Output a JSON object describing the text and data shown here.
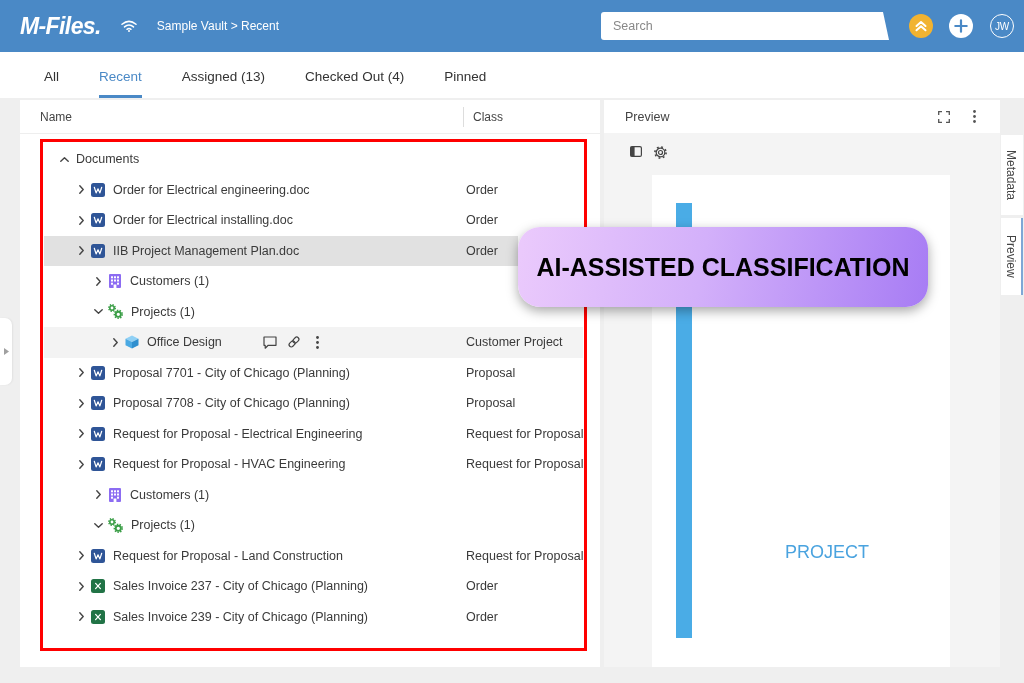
{
  "header": {
    "logo": "M-Files.",
    "breadcrumb": "Sample Vault > Recent",
    "search": {
      "placeholder": "Search"
    },
    "avatar": "JW"
  },
  "tabs": [
    {
      "label": "All",
      "selected": false
    },
    {
      "label": "Recent",
      "selected": true
    },
    {
      "label": "Assigned (13)",
      "selected": false
    },
    {
      "label": "Checked Out (4)",
      "selected": false
    },
    {
      "label": "Pinned",
      "selected": false
    }
  ],
  "list": {
    "columns": [
      "Name",
      "Class"
    ],
    "groups": [
      {
        "label": "Documents",
        "expanded": true,
        "items": [
          {
            "kind": "word",
            "name": "Order for Electrical engineering.doc",
            "class": "Order",
            "expanded": false,
            "selected": false,
            "hovered": false
          },
          {
            "kind": "word",
            "name": "Order for Electrical installing.doc",
            "class": "Order",
            "expanded": false,
            "selected": false,
            "hovered": false
          },
          {
            "kind": "word",
            "name": "IIB Project Management Plan.doc",
            "class": "Order",
            "expanded": false,
            "selected": true,
            "hovered": false,
            "children": [
              {
                "kind": "customers",
                "name": "Customers (1)",
                "expanded": false,
                "selected": false,
                "hovered": false
              },
              {
                "kind": "projects",
                "name": "Projects (1)",
                "expanded": true,
                "selected": false,
                "hovered": false,
                "children": [
                  {
                    "kind": "project",
                    "name": "Office Design",
                    "class": "Customer Project",
                    "expanded": false,
                    "selected": false,
                    "hovered": true
                  }
                ]
              }
            ]
          },
          {
            "kind": "word",
            "name": "Proposal 7701 - City of Chicago (Planning)",
            "class": "Proposal",
            "expanded": false,
            "selected": false,
            "hovered": false
          },
          {
            "kind": "word",
            "name": "Proposal 7708 - City of Chicago (Planning)",
            "class": "Proposal",
            "expanded": false,
            "selected": false,
            "hovered": false
          },
          {
            "kind": "word",
            "name": "Request for Proposal - Electrical Engineering",
            "class": "Request for Proposal",
            "expanded": false,
            "selected": false,
            "hovered": false
          },
          {
            "kind": "word",
            "name": "Request for Proposal - HVAC Engineering",
            "class": "Request for Proposal",
            "expanded": false,
            "selected": false,
            "hovered": false,
            "children": [
              {
                "kind": "customers",
                "name": "Customers (1)",
                "expanded": false,
                "selected": false,
                "hovered": false
              },
              {
                "kind": "projects",
                "name": "Projects (1)",
                "expanded": true,
                "selected": false,
                "hovered": false
              }
            ]
          },
          {
            "kind": "word",
            "name": "Request for Proposal - Land Construction",
            "class": "Request for Proposal",
            "expanded": false,
            "selected": false,
            "hovered": false
          },
          {
            "kind": "excel",
            "name": "Sales Invoice 237 - City of Chicago (Planning)",
            "class": "Order",
            "expanded": false,
            "selected": false,
            "hovered": false
          },
          {
            "kind": "excel",
            "name": "Sales Invoice 239 - City of Chicago (Planning)",
            "class": "Order",
            "expanded": false,
            "selected": false,
            "hovered": false
          }
        ]
      }
    ]
  },
  "preview": {
    "title": "Preview",
    "document": {
      "heading": "PROJECT"
    }
  },
  "side_tabs": [
    {
      "label": "Metadata",
      "selected": false
    },
    {
      "label": "Preview",
      "selected": true
    }
  ],
  "callout": {
    "text": "AI-ASSISTED CLASSIFICATION"
  }
}
